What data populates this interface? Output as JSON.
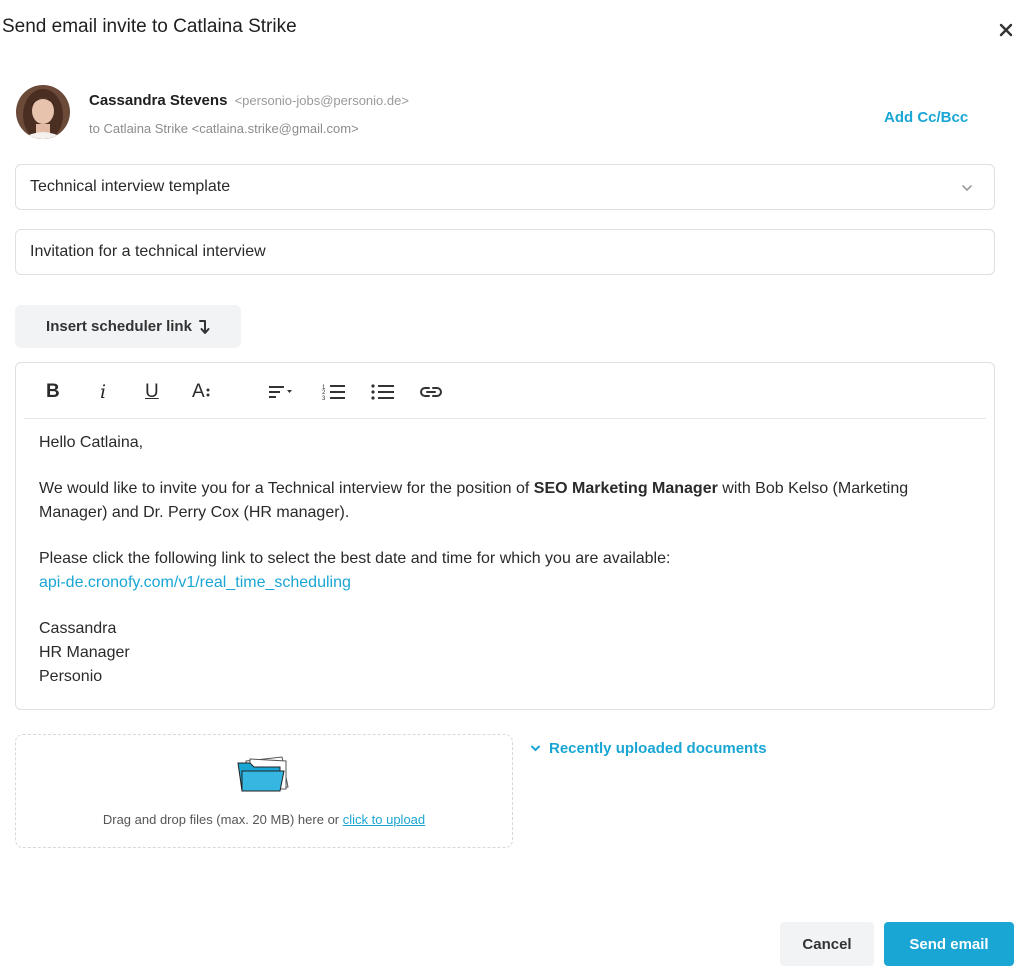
{
  "dialog": {
    "title": "Send email invite to Catlaina Strike",
    "close_icon": "close-icon"
  },
  "sender": {
    "name": "Cassandra Stevens",
    "email": "<personio-jobs@personio.de>",
    "to_line": "to Catlaina Strike <catlaina.strike@gmail.com>",
    "cc_bcc_label": "Add Cc/Bcc"
  },
  "template_select": {
    "value": "Technical interview template",
    "icon": "chevron-down-icon"
  },
  "subject": {
    "value": "Invitation for a technical interview"
  },
  "scheduler_button": {
    "label": "Insert scheduler link",
    "icon": "arrow-down-icon"
  },
  "toolbar": {
    "bold": "B",
    "italic": "i",
    "underline": "U",
    "font_size": "A",
    "align_icon": "align-icon",
    "ordered_list_icon": "ordered-list-icon",
    "bullet_list_icon": "bullet-list-icon",
    "link_icon": "link-icon"
  },
  "email_body": {
    "greeting": "Hello Catlaina,",
    "p1_before": "We would like to invite you for a Technical interview for the position of ",
    "p1_bold": "SEO Marketing Manager",
    "p1_after": " with Bob Kelso (Marketing Manager) and Dr. Perry Cox (HR manager).",
    "p2": "Please click the following link to select the best date and time for which you are available:",
    "link": "api-de.cronofy.com/v1/real_time_scheduling",
    "sign_name": "Cassandra",
    "sign_role": "HR Manager",
    "sign_company": "Personio"
  },
  "upload": {
    "text": "Drag and drop files (max. 20 MB) here or ",
    "link": "click to upload",
    "icon": "folder-icon"
  },
  "recent_docs": {
    "label": "Recently uploaded documents",
    "icon": "chevron-down-icon"
  },
  "footer": {
    "cancel": "Cancel",
    "send": "Send email"
  },
  "colors": {
    "accent": "#1aa6d4",
    "button_gray": "#f2f3f5"
  }
}
